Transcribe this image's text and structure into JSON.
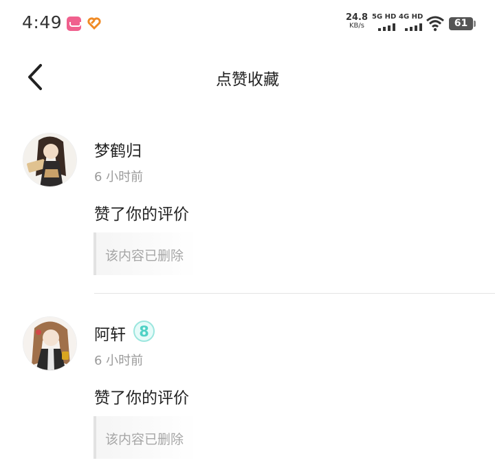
{
  "status_bar": {
    "time": "4:49",
    "net_speed": "24.8",
    "net_unit": "KB/s",
    "signal_1": "5G HD",
    "signal_2": "4G HD",
    "battery": "61",
    "icons": [
      "app-notification-icon",
      "app-heart-icon",
      "signal-icon",
      "wifi-icon",
      "battery-icon"
    ]
  },
  "header": {
    "title": "点赞收藏",
    "back_icon": "chevron-left-icon"
  },
  "feed": {
    "items": [
      {
        "username": "梦鹤归",
        "time": "6 小时前",
        "action": "赞了你的评价",
        "quote": "该内容已删除",
        "avatar_colors": [
          "#3a2a22",
          "#e8d2b8",
          "#c9a16a"
        ]
      },
      {
        "username": "阿轩",
        "badge": "8",
        "badge_color": "#4fd1c5",
        "time": "6 小时前",
        "action": "赞了你的评价",
        "quote": "该内容已删除",
        "avatar_colors": [
          "#a0704a",
          "#f0e0d0",
          "#2a2a2a"
        ]
      }
    ]
  }
}
